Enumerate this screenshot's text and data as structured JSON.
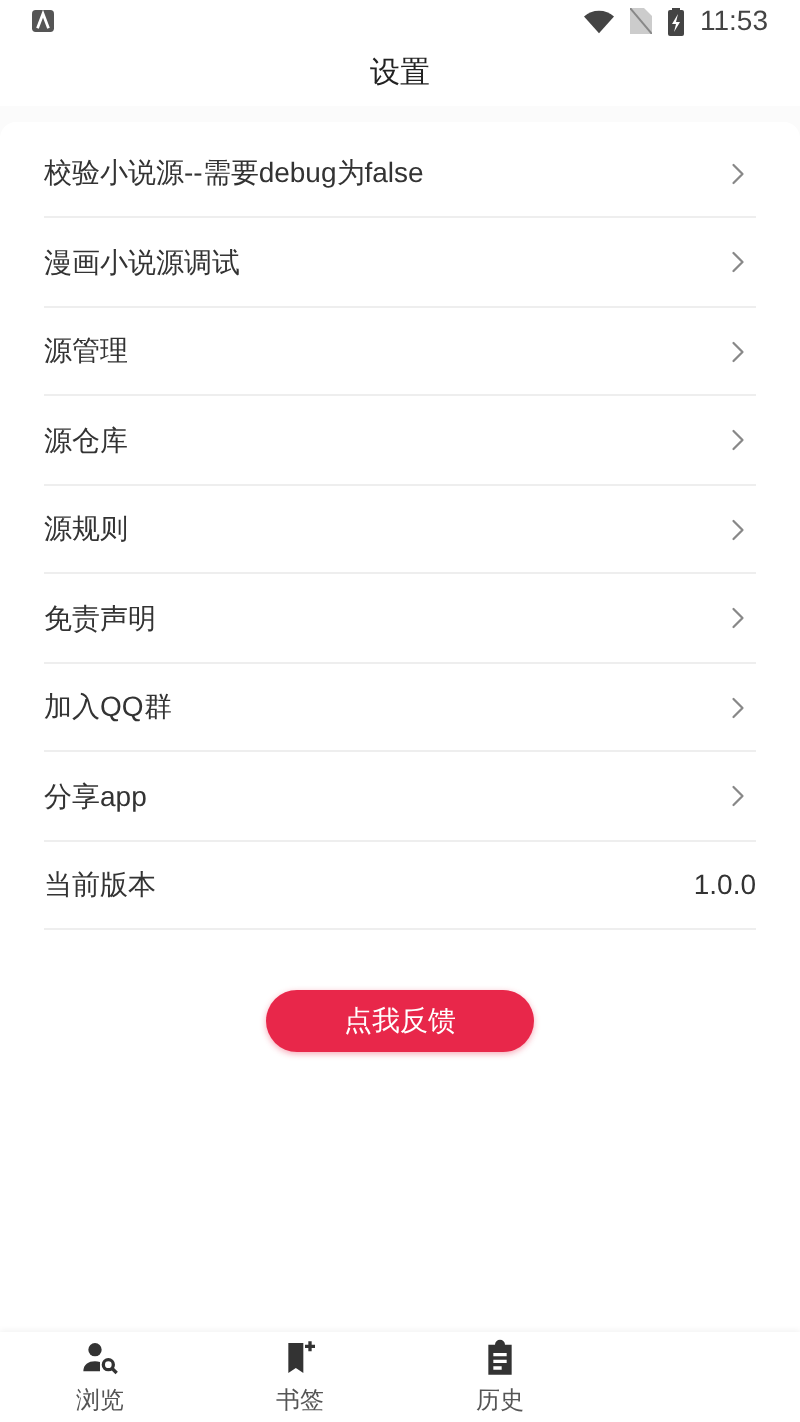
{
  "status_bar": {
    "time": "11:53"
  },
  "header": {
    "title": "设置"
  },
  "settings": [
    {
      "kind": "link",
      "label": "校验小说源--需要debug为false"
    },
    {
      "kind": "link",
      "label": "漫画小说源调试"
    },
    {
      "kind": "link",
      "label": "源管理"
    },
    {
      "kind": "link",
      "label": "源仓库"
    },
    {
      "kind": "link",
      "label": "源规则"
    },
    {
      "kind": "link",
      "label": "免责声明"
    },
    {
      "kind": "link",
      "label": "加入QQ群"
    },
    {
      "kind": "link",
      "label": "分享app"
    },
    {
      "kind": "value",
      "label": "当前版本",
      "value": "1.0.0"
    }
  ],
  "feedback_button": "点我反馈",
  "bottom_nav": [
    {
      "kind": "browse",
      "label": "浏览"
    },
    {
      "kind": "bookmark",
      "label": "书签"
    },
    {
      "kind": "history",
      "label": "历史"
    }
  ]
}
